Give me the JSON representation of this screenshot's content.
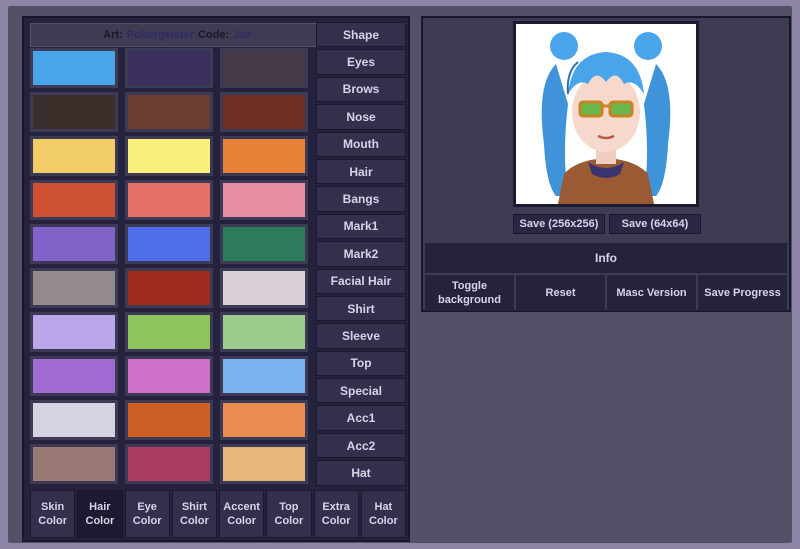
{
  "credit": {
    "art_label": "Art:",
    "art_name": "Poltergeister",
    "code_label": "Code:",
    "code_name": "Jaz"
  },
  "swatches": [
    [
      "#4aa4ea",
      "#3b2f5d",
      "#463a48"
    ],
    [
      "#3a2e2a",
      "#6a3e30",
      "#6e3024"
    ],
    [
      "#f4cd6b",
      "#faf07e",
      "#e98038"
    ],
    [
      "#ce5032",
      "#e8706a",
      "#e68ea4"
    ],
    [
      "#8062c8",
      "#4e6ee8",
      "#2e7a5a"
    ],
    [
      "#928a8c",
      "#a02c1e",
      "#dcd0d8"
    ],
    [
      "#baa6ea",
      "#8ec45c",
      "#9ecc8e"
    ],
    [
      "#a06ad2",
      "#ce70c8",
      "#7ab2f2"
    ],
    [
      "#d6d2e2",
      "#ce6026",
      "#e88c52"
    ],
    [
      "#9a7a74",
      "#aa3a5e",
      "#e6b67a"
    ]
  ],
  "side_tabs": [
    "Shape",
    "Eyes",
    "Brows",
    "Nose",
    "Mouth",
    "Hair",
    "Bangs",
    "Mark1",
    "Mark2",
    "Facial Hair",
    "Shirt",
    "Sleeve",
    "Top",
    "Special",
    "Acc1",
    "Acc2",
    "Hat"
  ],
  "bottom_tabs": [
    {
      "l1": "Skin",
      "l2": "Color"
    },
    {
      "l1": "Hair",
      "l2": "Color"
    },
    {
      "l1": "Eye",
      "l2": "Color"
    },
    {
      "l1": "Shirt",
      "l2": "Color"
    },
    {
      "l1": "Accent",
      "l2": "Color"
    },
    {
      "l1": "Top",
      "l2": "Color"
    },
    {
      "l1": "Extra",
      "l2": "Color"
    },
    {
      "l1": "Hat",
      "l2": "Color"
    }
  ],
  "active_bottom_tab": 1,
  "save": {
    "large": "Save (256x256)",
    "small": "Save (64x64)"
  },
  "info": "Info",
  "actions": {
    "toggle_l1": "Toggle",
    "toggle_l2": "background",
    "reset": "Reset",
    "masc": "Masc Version",
    "progress": "Save Progress"
  }
}
